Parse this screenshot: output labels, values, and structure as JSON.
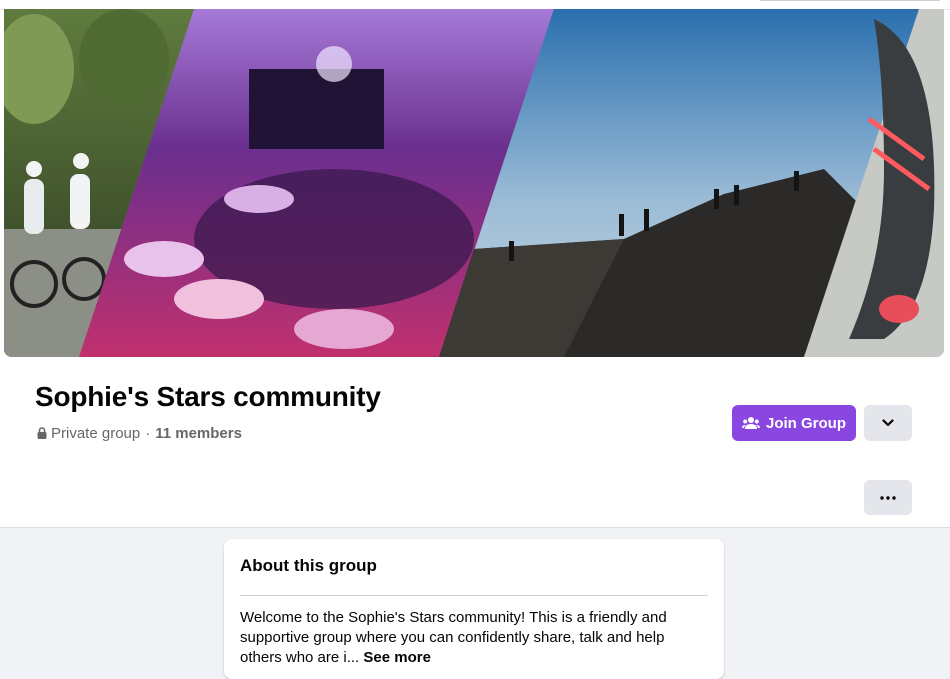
{
  "group": {
    "name": "Sophie's Stars community",
    "privacy": "Private group",
    "separator": "·",
    "members": "11 members"
  },
  "actions": {
    "join_label": "Join Group"
  },
  "about": {
    "title": "About this group",
    "description": "Welcome to the Sophie's Stars community! This is a friendly and supportive group where you can confidently share, talk and help others who are i...",
    "see_more": "See more"
  },
  "colors": {
    "accent": "#8a46e0",
    "secondary_button": "#e4e6eb",
    "page_background": "#f0f2f5"
  },
  "icons": {
    "privacy": "lock-icon",
    "join": "people-icon",
    "dropdown": "chevron-down-icon",
    "more": "ellipsis-icon"
  }
}
